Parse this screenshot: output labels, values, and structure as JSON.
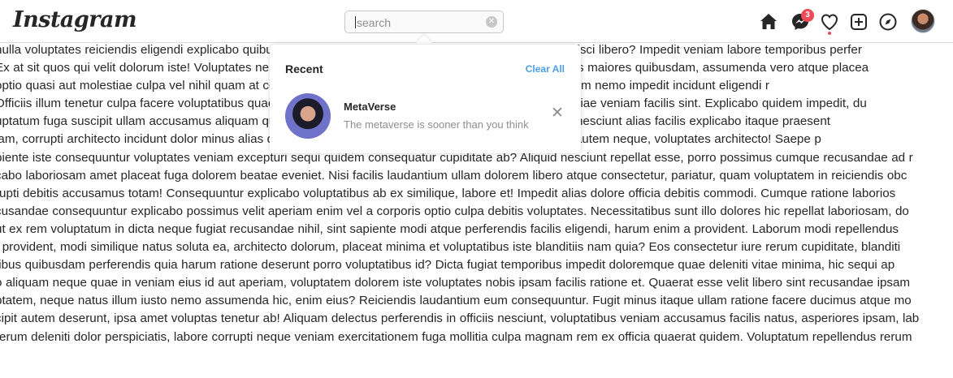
{
  "app": {
    "logo": "Instagram"
  },
  "search": {
    "placeholder": "search",
    "value": ""
  },
  "nav": {
    "messages_badge": "3"
  },
  "dropdown": {
    "title": "Recent",
    "clear_all": "Clear All",
    "results": [
      {
        "name": "MetaVerse",
        "subtitle": "The metaverse is sooner than you think"
      }
    ]
  },
  "body_lines": [
    "nulla voluptates reiciendis eligendi explicabo quibusdam aut, ullam labore harum? Quisquam odio vel adipisci libero? Impedit veniam labore temporibus perfer",
    "Ex at sit quos qui velit dolorum iste! Voluptates nemo praesentium, obcaecati aut repellendus dolores natus maiores quibusdam, assumenda vero atque placea",
    "optio quasi aut molestiae culpa vel nihil quam at consequuntur, eligendi temporibus? Numquam natus harum nemo impedit incidunt eligendi r",
    "Officiis illum tenetur culpa facere voluptatibus quae, doloremque eum eos praesentium, unde rerunt molestiae veniam facilis sint. Explicabo quidem impedit, du",
    "uptatum fuga suscipit ullam accusamus aliquam quasi, tempore ullam facilis incidunt, optio porro laborum nesciunt alias facilis explicabo itaque praesent",
    "lam, corrupti architecto incidunt dolor minus alias quos ducimus, debitis, repudiandae, similique provident autem neque, voluptates architecto! Saepe p",
    "piente iste consequuntur voluptates veniam excepturi sequi quidem consequatur cupiditate ab? Aliquid nesciunt repellat esse, porro possimus cumque recusandae ad r",
    "cabo laboriosam amet placeat fuga dolorem beatae eveniet. Nisi facilis laudantium ullam dolorem libero atque consectetur, pariatur, quam voluptatem in reiciendis obc",
    "rupti debitis accusamus totam! Consequuntur explicabo voluptatibus ab ex similique, labore et! Impedit alias dolore officia debitis commodi. Cumque ratione laborios",
    "cusandae consequuntur explicabo possimus velit aperiam enim vel a corporis optio culpa debitis voluptates. Necessitatibus sunt illo dolores hic repellat laboriosam, do",
    "ut ex rem voluptatum in dicta neque fugiat recusandae nihil, sint sapiente modi atque perferendis facilis eligendi, harum enim a provident. Laborum modi repellendus",
    "t provident, modi similique natus soluta ea, architecto dolorum, placeat minima et voluptatibus iste blanditiis nam quia? Eos consectetur iure rerum cupiditate, blanditi",
    "tibus quibusdam perferendis quia harum ratione deserunt porro voluptatibus id? Dicta fugiat temporibus impedit doloremque quae deleniti vitae minima, hic sequi ap",
    "o aliquam neque quae in veniam eius id aut aperiam, voluptatem dolorem iste voluptates nobis ipsam facilis ratione et. Quaerat esse velit libero sint recusandae ipsam",
    "ptatem, neque natus illum iusto nemo assumenda hic, enim eius? Reiciendis laudantium eum consequuntur. Fugit minus itaque ullam ratione facere ducimus atque mo",
    "cipit autem deserunt, ipsa amet voluptas tenetur ab! Aliquam delectus perferendis in officiis nesciunt, voluptatibus veniam accusamus facilis natus, asperiores ipsam, lab",
    "rerum deleniti dolor perspiciatis, labore corrupti neque veniam exercitationem fuga mollitia culpa magnam rem ex officia quaerat quidem. Voluptatum repellendus rerum"
  ]
}
